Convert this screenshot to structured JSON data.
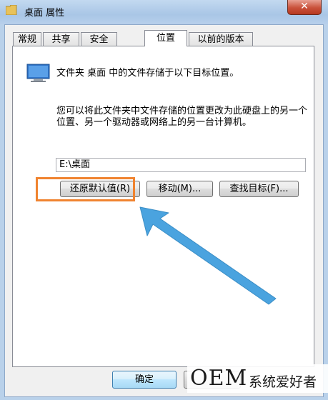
{
  "window": {
    "title": "桌面 属性",
    "close_label": "✕"
  },
  "tabs": [
    {
      "label": "常规"
    },
    {
      "label": "共享"
    },
    {
      "label": "安全"
    },
    {
      "label": "位置"
    },
    {
      "label": "以前的版本"
    }
  ],
  "active_tab": "位置",
  "location": {
    "description": "文件夹 桌面 中的文件存储于以下目标位置。",
    "info": "您可以将此文件夹中文件存储的位置更改为此硬盘上的另一个位置、另一个驱动器或网络上的另一台计算机。",
    "path_value": "E:\\桌面"
  },
  "buttons": {
    "restore_default": "还原默认值(R)",
    "move": "移动(M)...",
    "find_target": "查找目标(F)...",
    "ok": "确定",
    "cancel": ""
  },
  "annotation": {
    "highlight_color": "#f0832f",
    "arrow_color": "#4aa3df"
  },
  "watermark": {
    "brand": "OEM",
    "text": "系统爱好者"
  }
}
